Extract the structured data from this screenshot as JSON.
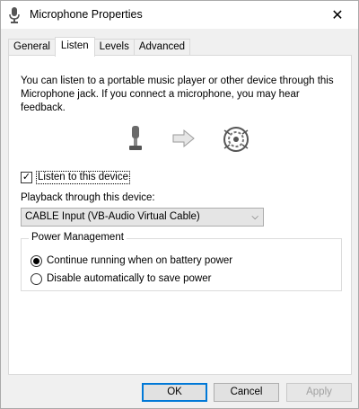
{
  "window": {
    "title": "Microphone Properties",
    "close_glyph": "✕"
  },
  "tabs": [
    {
      "label": "General"
    },
    {
      "label": "Listen"
    },
    {
      "label": "Levels"
    },
    {
      "label": "Advanced"
    }
  ],
  "listen": {
    "description": "You can listen to a portable music player or other device through this Microphone jack.  If you connect a microphone, you may hear feedback.",
    "listen_checkbox": {
      "label": "Listen to this device",
      "checked": true,
      "check_glyph": "✓"
    },
    "playback_label": "Playback through this device:",
    "playback_select": {
      "value": "CABLE Input (VB-Audio Virtual Cable)",
      "arrow_glyph": "⌵"
    }
  },
  "power_management": {
    "title": "Power Management",
    "options": [
      {
        "label": "Continue running when on battery power",
        "selected": true
      },
      {
        "label": "Disable automatically to save power",
        "selected": false
      }
    ]
  },
  "buttons": {
    "ok": "OK",
    "cancel": "Cancel",
    "apply": "Apply"
  },
  "icons": {
    "title": "microphone-icon",
    "microphone": "microphone-icon",
    "arrow": "arrow-right-icon",
    "speaker": "speaker-icon"
  },
  "colors": {
    "accent": "#0078d7",
    "window_bg": "#f0f0f0",
    "panel_bg": "#ffffff"
  }
}
